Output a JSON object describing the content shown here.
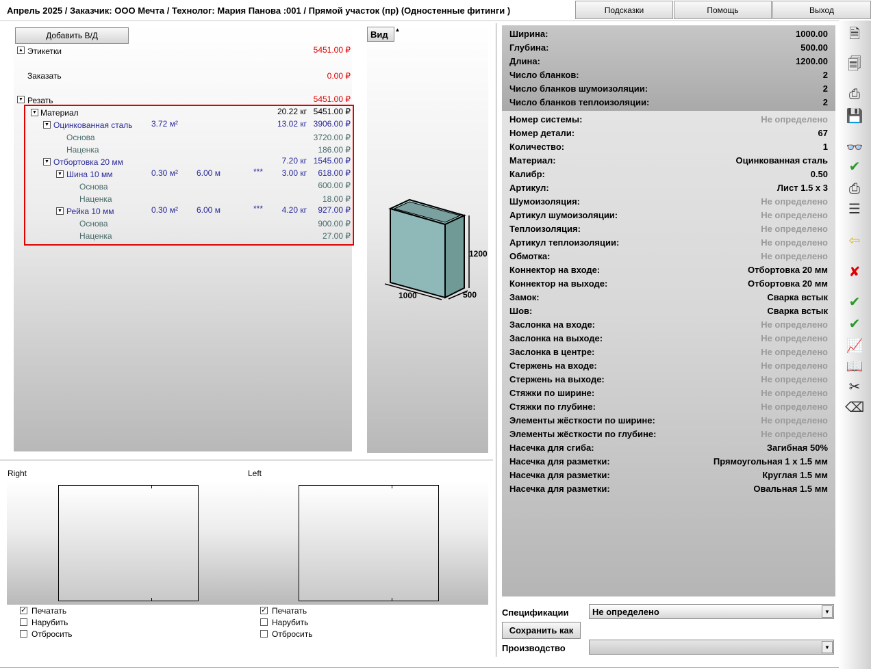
{
  "title": "Апрель 2025 / Заказчик: ООО Мечта / Технолог: Мария Панова   :001 / Прямой участок (пр) (Одностенные фитинги )",
  "topbar": {
    "hints": "Подсказки",
    "help": "Помощь",
    "exit": "Выход"
  },
  "tree": {
    "add_button": "Добавить В/Д",
    "labels": {
      "label": "Этикетки",
      "label_price": "5451.00 ₽"
    },
    "order": {
      "label": "Заказать",
      "price": "0.00 ₽"
    },
    "cut": {
      "label": "Резать",
      "price": "5451.00 ₽"
    },
    "material": {
      "label": "Материал",
      "weight": "20.22 кг",
      "price": "5451.00 ₽"
    },
    "steel": {
      "label": "Оцинкованная сталь",
      "area": "3.72 м²",
      "weight": "13.02 кг",
      "price": "3906.00 ₽"
    },
    "steel_base": {
      "label": "Основа",
      "price": "3720.00 ₽"
    },
    "steel_markup": {
      "label": "Наценка",
      "price": "186.00 ₽"
    },
    "flange": {
      "label": "Отбортовка 20 мм",
      "weight": "7.20 кг",
      "price": "1545.00 ₽"
    },
    "bus": {
      "label": "Шина 10 мм",
      "area": "0.30 м²",
      "length": "6.00 м",
      "stars": "***",
      "weight": "3.00 кг",
      "price": "618.00 ₽"
    },
    "bus_base": {
      "label": "Основа",
      "price": "600.00 ₽"
    },
    "bus_markup": {
      "label": "Наценка",
      "price": "18.00 ₽"
    },
    "rail": {
      "label": "Рейка 10 мм",
      "area": "0.30 м²",
      "length": "6.00 м",
      "stars": "***",
      "weight": "4.20 кг",
      "price": "927.00 ₽"
    },
    "rail_base": {
      "label": "Основа",
      "price": "900.00 ₽"
    },
    "rail_markup": {
      "label": "Наценка",
      "price": "27.00 ₽"
    }
  },
  "view": {
    "tab": "Вид",
    "dim_height": "1200",
    "dim_width": "1000",
    "dim_depth": "500"
  },
  "props_top": [
    {
      "label": "Ширина:",
      "value": "1000.00"
    },
    {
      "label": "Глубина:",
      "value": "500.00"
    },
    {
      "label": "Длина:",
      "value": "1200.00"
    },
    {
      "label": "Число бланков:",
      "value": "2"
    },
    {
      "label": "Число бланков шумоизоляции:",
      "value": "2"
    },
    {
      "label": "Число бланков теплоизоляции:",
      "value": "2"
    }
  ],
  "props": [
    {
      "label": "Номер системы:",
      "value": "Не определено",
      "muted": true
    },
    {
      "label": "Номер детали:",
      "value": "67",
      "muted": false
    },
    {
      "label": "Количество:",
      "value": "1",
      "muted": false
    },
    {
      "label": "Материал:",
      "value": "Оцинкованная сталь",
      "muted": false
    },
    {
      "label": "Калибр:",
      "value": "0.50",
      "muted": false
    },
    {
      "label": "Артикул:",
      "value": "Лист 1.5 x 3",
      "muted": false
    },
    {
      "label": "Шумоизоляция:",
      "value": "Не определено",
      "muted": true
    },
    {
      "label": "Артикул шумоизоляции:",
      "value": "Не определено",
      "muted": true
    },
    {
      "label": "Теплоизоляция:",
      "value": "Не определено",
      "muted": true
    },
    {
      "label": "Артикул теплоизоляции:",
      "value": "Не определено",
      "muted": true
    },
    {
      "label": "Обмотка:",
      "value": "Не определено",
      "muted": true
    },
    {
      "label": "Коннектор на входе:",
      "value": "Отбортовка 20 мм",
      "muted": false
    },
    {
      "label": "Коннектор на выходе:",
      "value": "Отбортовка 20 мм",
      "muted": false
    },
    {
      "label": "Замок:",
      "value": "Сварка встык",
      "muted": false
    },
    {
      "label": "Шов:",
      "value": "Сварка встык",
      "muted": false
    },
    {
      "label": "Заслонка на входе:",
      "value": "Не определено",
      "muted": true
    },
    {
      "label": "Заслонка на выходе:",
      "value": "Не определено",
      "muted": true
    },
    {
      "label": "Заслонка в центре:",
      "value": "Не определено",
      "muted": true
    },
    {
      "label": "Стержень на входе:",
      "value": "Не определено",
      "muted": true
    },
    {
      "label": "Стержень на выходе:",
      "value": "Не определено",
      "muted": true
    },
    {
      "label": "Стяжки по ширине:",
      "value": "Не определено",
      "muted": true
    },
    {
      "label": "Стяжки по глубине:",
      "value": "Не определено",
      "muted": true
    },
    {
      "label": "Элементы жёсткости по ширине:",
      "value": "Не определено",
      "muted": true
    },
    {
      "label": "Элементы жёсткости по глубине:",
      "value": "Не определено",
      "muted": true
    },
    {
      "label": "Насечка для сгиба:",
      "value": "Загибная 50%",
      "muted": false
    },
    {
      "label": "Насечка для разметки:",
      "value": "Прямоугольная 1 x 1.5 мм",
      "muted": false
    },
    {
      "label": "Насечка для разметки:",
      "value": "Круглая 1.5 мм",
      "muted": false
    },
    {
      "label": "Насечка для разметки:",
      "value": "Овальная 1.5 мм",
      "muted": false
    }
  ],
  "bottom": {
    "right": {
      "title": "Right",
      "print": "Печатать",
      "print_checked": true,
      "cut": "Нарубить",
      "cut_checked": false,
      "discard": "Отбросить",
      "discard_checked": false
    },
    "left": {
      "title": "Left",
      "print": "Печатать",
      "print_checked": true,
      "cut": "Нарубить",
      "cut_checked": false,
      "discard": "Отбросить",
      "discard_checked": false
    }
  },
  "spec": {
    "label": "Спецификации",
    "value": "Не определено",
    "save_as": "Сохранить как",
    "production_label": "Производство",
    "production_value": ""
  },
  "toolbar_icons": [
    "print-preview-icon",
    "print-setup-icon",
    "print-icon",
    "save-icon",
    "search-icon",
    "note-check-icon",
    "print-alt-icon",
    "document-list-icon",
    "back-arrow-icon",
    "delete-icon",
    "doc-check-icon",
    "docs-check-icon",
    "chart-icon",
    "book-icon",
    "scissors-icon",
    "eraser-icon"
  ],
  "colors": {
    "price_red": "#e00000",
    "tree_blue": "#2b2b9a",
    "highlight_red": "#e00000",
    "box_fill": "#8fb8b8"
  }
}
